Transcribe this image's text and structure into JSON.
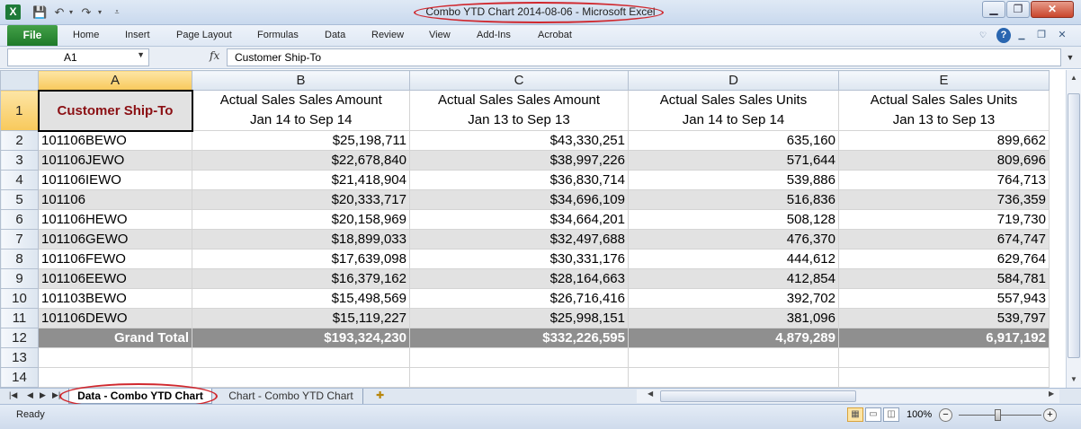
{
  "app": {
    "logo_letter": "X",
    "title": "Combo YTD Chart 2014-08-06  -  Microsoft Excel",
    "accent_color": "#1e7a38"
  },
  "qat": {
    "save_icon": "save-icon",
    "undo_icon": "undo-icon",
    "redo_icon": "redo-icon",
    "customize_icon": "customize-qat-icon"
  },
  "window": {
    "minimize_icon": "minimize-icon",
    "maximize_icon": "restore-icon",
    "close_icon": "close-icon"
  },
  "ribbon": {
    "file_label": "File",
    "tabs": [
      "Home",
      "Insert",
      "Page Layout",
      "Formulas",
      "Data",
      "Review",
      "View",
      "Add-Ins",
      "Acrobat"
    ]
  },
  "formula_bar": {
    "name_box": "A1",
    "fx": "fx",
    "formula": "Customer Ship-To"
  },
  "sheet": {
    "columns": [
      "A",
      "B",
      "C",
      "D",
      "E"
    ],
    "row_numbers": [
      "1",
      "2",
      "3",
      "4",
      "5",
      "6",
      "7",
      "8",
      "9",
      "10",
      "11",
      "12",
      "13",
      "14"
    ],
    "header": {
      "a": "Customer Ship-To",
      "b_line1": "Actual Sales Sales Amount",
      "b_line2": "Jan 14 to Sep 14",
      "c_line1": "Actual Sales Sales Amount",
      "c_line2": "Jan 13 to Sep 13",
      "d_line1": "Actual Sales Sales Units",
      "d_line2": "Jan 14 to Sep 14",
      "e_line1": "Actual Sales Sales Units",
      "e_line2": "Jan 13 to Sep 13"
    },
    "rows": [
      [
        "101106BEWO",
        "$25,198,711",
        "$43,330,251",
        "635,160",
        "899,662"
      ],
      [
        "101106JEWO",
        "$22,678,840",
        "$38,997,226",
        "571,644",
        "809,696"
      ],
      [
        "101106IEWO",
        "$21,418,904",
        "$36,830,714",
        "539,886",
        "764,713"
      ],
      [
        "101106",
        "$20,333,717",
        "$34,696,109",
        "516,836",
        "736,359"
      ],
      [
        "101106HEWO",
        "$20,158,969",
        "$34,664,201",
        "508,128",
        "719,730"
      ],
      [
        "101106GEWO",
        "$18,899,033",
        "$32,497,688",
        "476,370",
        "674,747"
      ],
      [
        "101106FEWO",
        "$17,639,098",
        "$30,331,176",
        "444,612",
        "629,764"
      ],
      [
        "101106EEWO",
        "$16,379,162",
        "$28,164,663",
        "412,854",
        "584,781"
      ],
      [
        "101103BEWO",
        "$15,498,569",
        "$26,716,416",
        "392,702",
        "557,943"
      ],
      [
        "101106DEWO",
        "$15,119,227",
        "$25,998,151",
        "381,096",
        "539,797"
      ]
    ],
    "total": [
      "Grand Total",
      "$193,324,230",
      "$332,226,595",
      "4,879,289",
      "6,917,192"
    ]
  },
  "sheet_tabs": {
    "active": "Data - Combo YTD Chart",
    "other": "Chart - Combo YTD Chart"
  },
  "status": {
    "ready": "Ready",
    "zoom": "100%",
    "zoom_minus": "−",
    "zoom_plus": "+"
  }
}
